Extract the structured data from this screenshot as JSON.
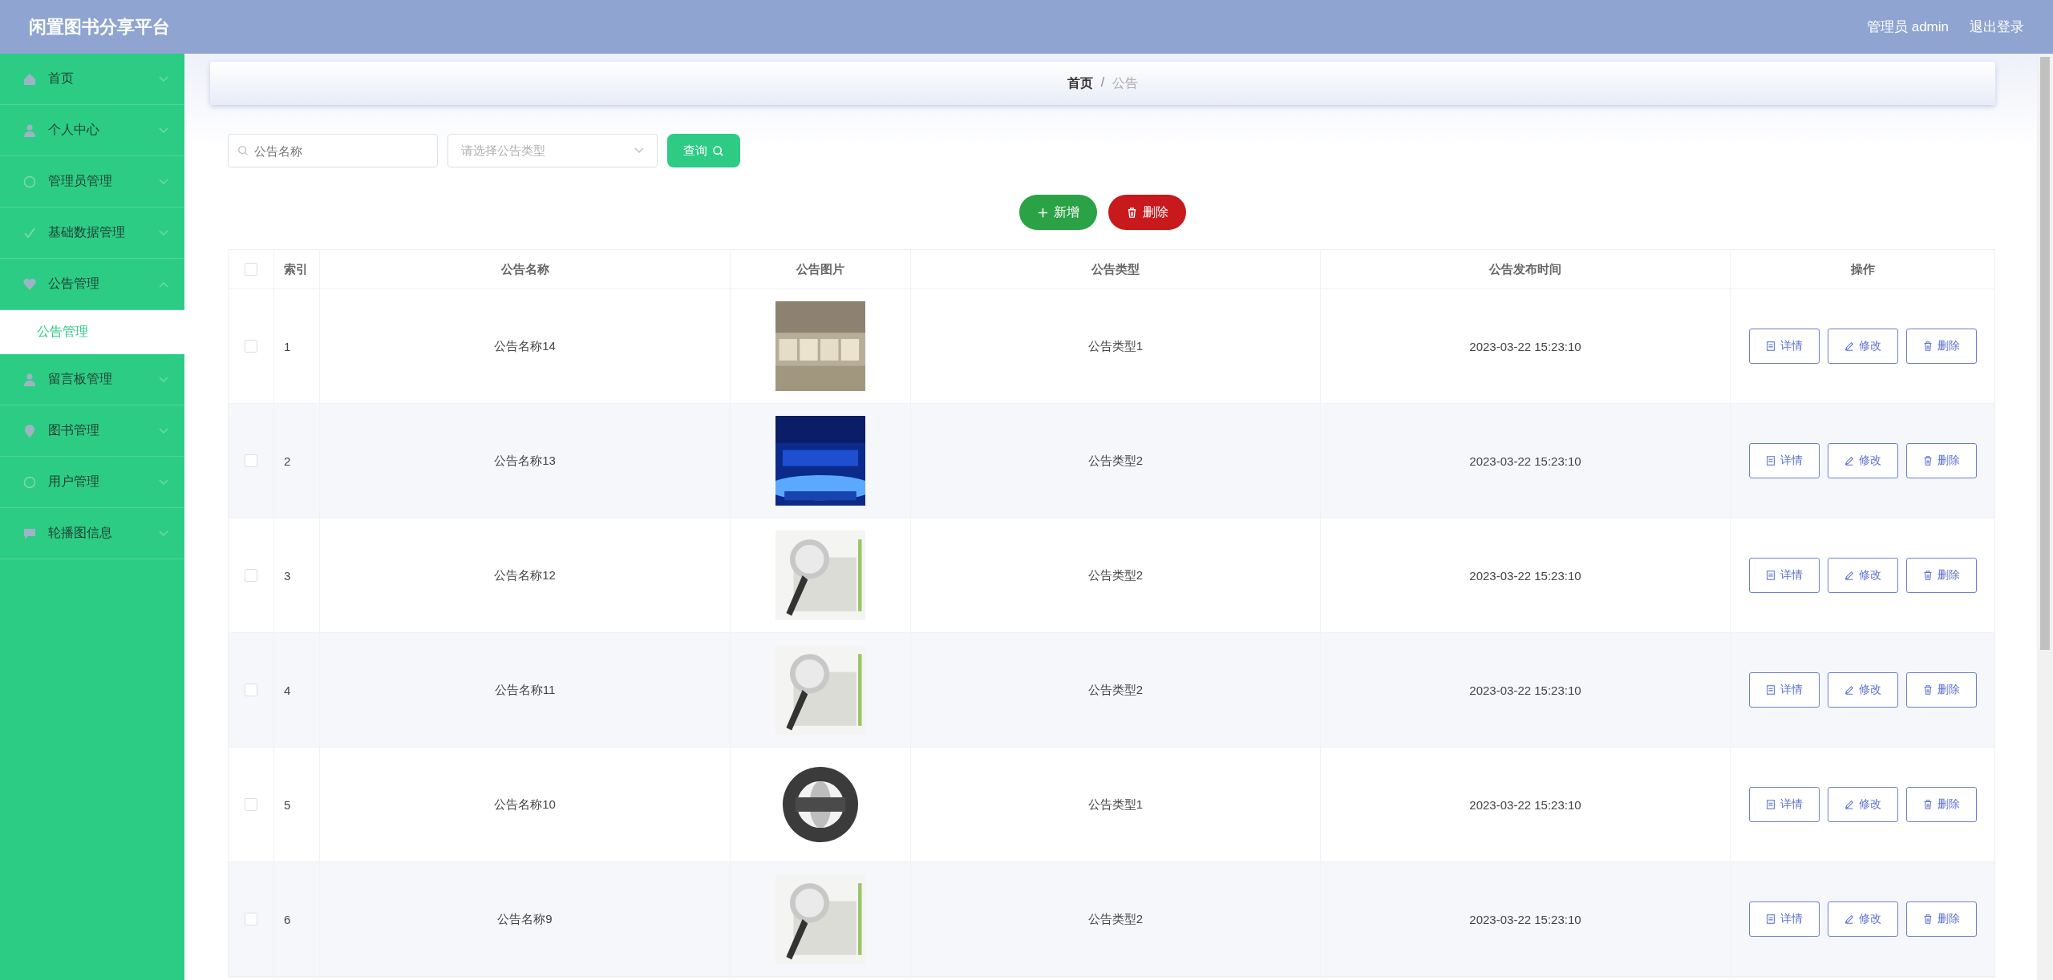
{
  "header": {
    "title": "闲置图书分享平台",
    "user": "管理员 admin",
    "logout": "退出登录"
  },
  "sidebar": {
    "items": [
      {
        "label": "首页",
        "selected": false,
        "expanded": false
      },
      {
        "label": "个人中心",
        "selected": false,
        "expanded": false
      },
      {
        "label": "管理员管理",
        "selected": false,
        "expanded": false
      },
      {
        "label": "基础数据管理",
        "selected": false,
        "expanded": false
      },
      {
        "label": "公告管理",
        "selected": false,
        "expanded": true,
        "children": [
          {
            "label": "公告管理",
            "selected": true
          }
        ]
      },
      {
        "label": "留言板管理",
        "selected": false,
        "expanded": false
      },
      {
        "label": "图书管理",
        "selected": false,
        "expanded": false
      },
      {
        "label": "用户管理",
        "selected": false,
        "expanded": false
      },
      {
        "label": "轮播图信息",
        "selected": false,
        "expanded": false
      }
    ]
  },
  "breadcrumb": {
    "items": [
      "首页",
      "公告"
    ],
    "separator": "/"
  },
  "search": {
    "name_placeholder": "公告名称",
    "type_placeholder": "请选择公告类型",
    "query": "查询"
  },
  "actions": {
    "add": "新增",
    "delete": "删除"
  },
  "table": {
    "all_checked": false,
    "columns": [
      "索引",
      "公告名称",
      "公告图片",
      "公告类型",
      "公告发布时间",
      "操作"
    ],
    "rows": [
      {
        "checked": false,
        "index": "1",
        "name": "公告名称14",
        "type": "公告类型1",
        "time": "2023-03-22 15:23:10",
        "ops": [
          "详情",
          "修改",
          "删除"
        ]
      },
      {
        "checked": false,
        "index": "2",
        "name": "公告名称13",
        "type": "公告类型2",
        "time": "2023-03-22 15:23:10",
        "ops": [
          "详情",
          "修改",
          "删除"
        ]
      },
      {
        "checked": false,
        "index": "3",
        "name": "公告名称12",
        "type": "公告类型2",
        "time": "2023-03-22 15:23:10",
        "ops": [
          "详情",
          "修改",
          "删除"
        ]
      },
      {
        "checked": false,
        "index": "4",
        "name": "公告名称11",
        "type": "公告类型2",
        "time": "2023-03-22 15:23:10",
        "ops": [
          "详情",
          "修改",
          "删除"
        ]
      },
      {
        "checked": false,
        "index": "5",
        "name": "公告名称10",
        "type": "公告类型1",
        "time": "2023-03-22 15:23:10",
        "ops": [
          "详情",
          "修改",
          "删除"
        ]
      },
      {
        "checked": false,
        "index": "6",
        "name": "公告名称9",
        "type": "公告类型2",
        "time": "2023-03-22 15:23:10",
        "ops": [
          "详情",
          "修改",
          "删除"
        ]
      }
    ]
  }
}
